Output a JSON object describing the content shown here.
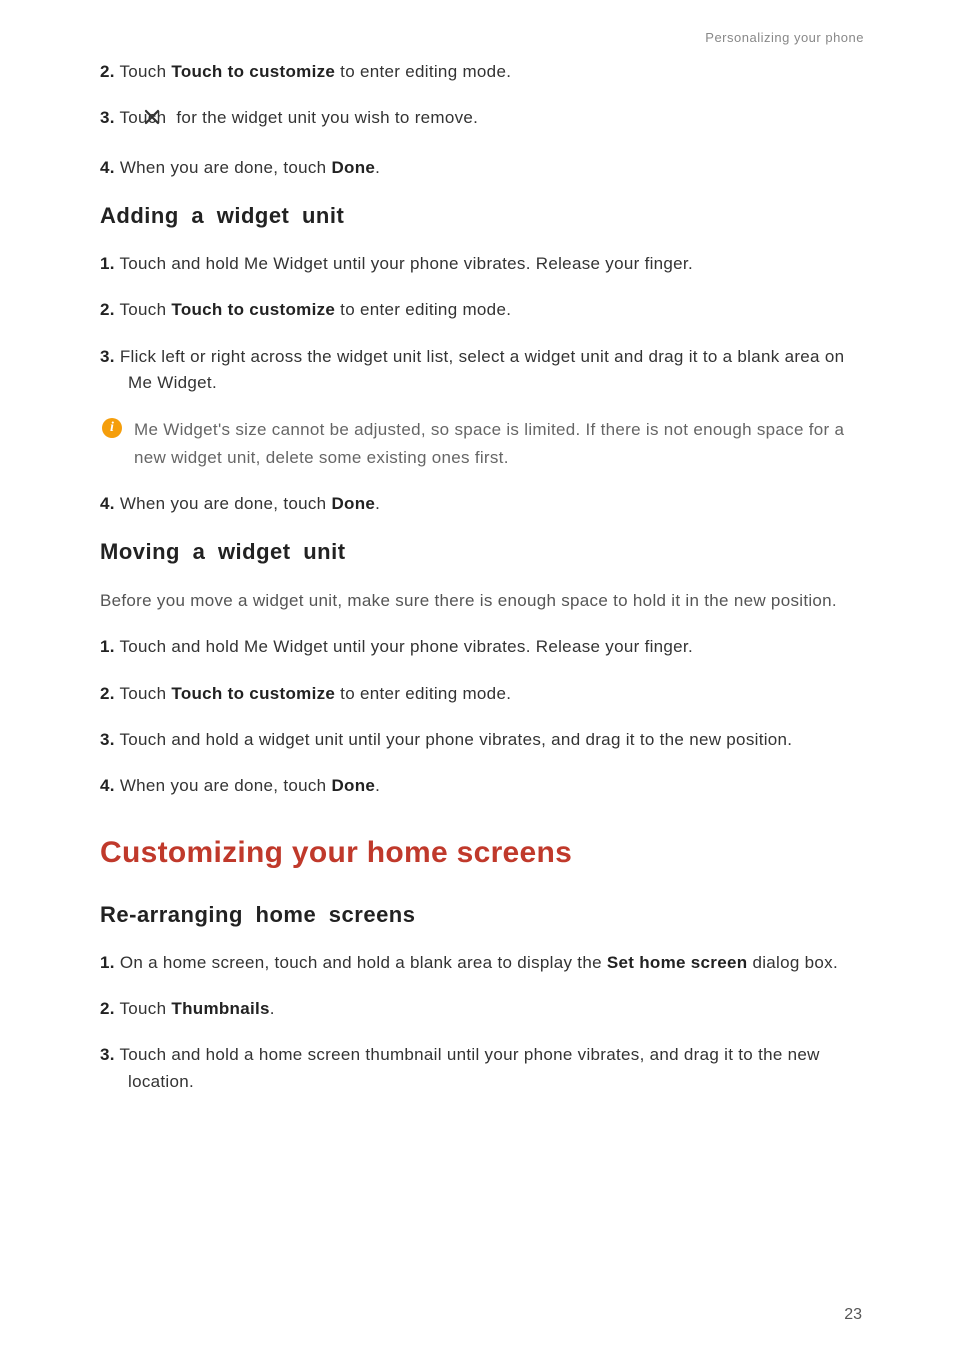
{
  "header": "Personalizing your phone",
  "page_number": "23",
  "icons": {
    "close_x": "close-icon",
    "info_i": "i"
  },
  "top_steps": [
    {
      "num": "2.",
      "pre": "Touch ",
      "bold": "Touch to customize",
      "post": " to enter editing mode."
    },
    {
      "num": "3.",
      "pre": "Touch ",
      "icon": true,
      "post": " for the widget unit you wish to remove."
    },
    {
      "num": "4.",
      "pre": "When you are done, touch ",
      "bold": "Done",
      "post": "."
    }
  ],
  "section_adding": {
    "title": "Adding a widget unit",
    "steps_before_note": [
      {
        "num": "1.",
        "pre": "Touch and hold Me Widget until your phone vibrates. Release your finger."
      },
      {
        "num": "2.",
        "pre": "Touch ",
        "bold": "Touch to customize",
        "post": " to enter editing mode."
      },
      {
        "num": "3.",
        "pre": "Flick left or right across the widget unit list, select a widget unit and drag it to a blank area on Me Widget."
      }
    ],
    "note": "Me Widget's size cannot be adjusted, so space is limited. If there is not enough space for a new widget unit, delete some existing ones first.",
    "steps_after_note": [
      {
        "num": "4.",
        "pre": "When you are done, touch ",
        "bold": "Done",
        "post": "."
      }
    ]
  },
  "section_moving": {
    "title": "Moving a widget unit",
    "intro": "Before you move a widget unit, make sure there is enough space to hold it in the new position.",
    "steps": [
      {
        "num": "1.",
        "pre": "Touch and hold Me Widget until your phone vibrates. Release your finger."
      },
      {
        "num": "2.",
        "pre": "Touch ",
        "bold": "Touch to customize",
        "post": " to enter editing mode."
      },
      {
        "num": "3.",
        "pre": "Touch and hold a widget unit until your phone vibrates, and drag it to the new position."
      },
      {
        "num": "4.",
        "pre": "When you are done, touch ",
        "bold": "Done",
        "post": "."
      }
    ]
  },
  "section_customizing": {
    "title": "Customizing your home screens"
  },
  "section_rearranging": {
    "title": "Re-arranging home screens",
    "steps": [
      {
        "num": "1.",
        "pre": "On a home screen, touch and hold a blank area to display the ",
        "bold": "Set home screen",
        "post": " dialog box."
      },
      {
        "num": "2.",
        "pre": "Touch ",
        "bold": "Thumbnails",
        "post": "."
      },
      {
        "num": "3.",
        "pre": "Touch and hold a home screen thumbnail until your phone vibrates, and drag it to the new location."
      }
    ]
  }
}
